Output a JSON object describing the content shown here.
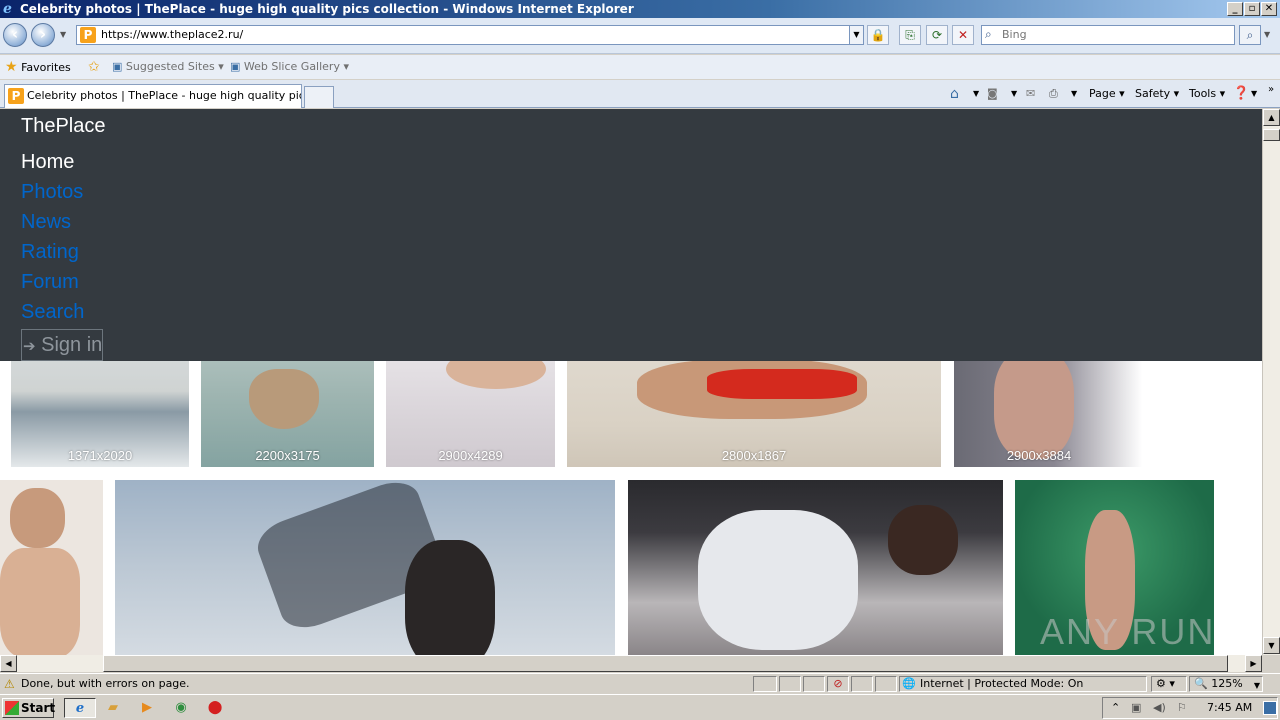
{
  "window": {
    "title": "Celebrity photos | ThePlace - huge high quality pics collection - Windows Internet Explorer",
    "buttons": [
      "_",
      "▫",
      "✕"
    ]
  },
  "address_bar": {
    "url": "https://www.theplace2.ru/",
    "search_placeholder": "Bing"
  },
  "favorites_bar": {
    "favorites_label": "Favorites",
    "items": [
      "Suggested Sites ▾",
      "Web Slice Gallery ▾"
    ]
  },
  "tabs": [
    {
      "label": "Celebrity photos | ThePlace - huge high quality pics co..."
    }
  ],
  "command_bar": {
    "page": "Page ▾",
    "safety": "Safety ▾",
    "tools": "Tools ▾"
  },
  "site": {
    "brand": "ThePlace",
    "nav": [
      "Home",
      "Photos",
      "News",
      "Rating",
      "Forum",
      "Search"
    ],
    "signin": "Sign in",
    "signin_icon": "sign-in-arrow-icon"
  },
  "photos_row1": [
    {
      "dimensions": "1371x2020"
    },
    {
      "dimensions": "2200x3175"
    },
    {
      "dimensions": "2900x4289"
    },
    {
      "dimensions": "2800x1867"
    },
    {
      "dimensions": "2900x3884"
    }
  ],
  "status_bar": {
    "message": "Done, but with errors on page.",
    "zone": "Internet | Protected Mode: On",
    "zoom": "125%"
  },
  "taskbar": {
    "start": "Start",
    "clock": "7:45 AM"
  },
  "watermark": "ANY RUN"
}
